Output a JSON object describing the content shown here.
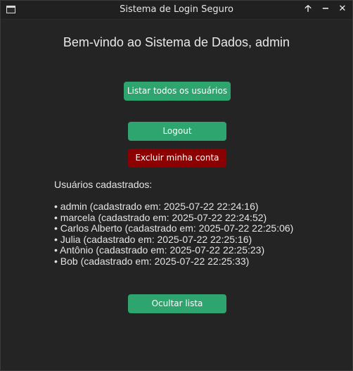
{
  "window": {
    "title": "Sistema de Login Seguro",
    "maximize_glyph": "🡡",
    "minimize_glyph": "−",
    "close_glyph": "✕"
  },
  "main": {
    "welcome": "Bem-vindo ao Sistema de Dados, admin",
    "list_users_label": "Listar todos os usuários",
    "logout_label": "Logout",
    "delete_account_label": "Excluir minha conta",
    "users_heading": "Usuários cadastrados:",
    "users": [
      "• admin (cadastrado em: 2025-07-22 22:24:16)",
      "• marcela (cadastrado em: 2025-07-22 22:24:52)",
      "• Carlos Alberto (cadastrado em: 2025-07-22 22:25:06)",
      "• Julia (cadastrado em: 2025-07-22 22:25:16)",
      "• Antônio (cadastrado em: 2025-07-22 22:25:23)",
      "• Bob (cadastrado em: 2025-07-22 22:25:33)"
    ],
    "hide_list_label": "Ocultar lista"
  },
  "colors": {
    "background": "#242424",
    "accent_green": "#2ea56f",
    "danger_red": "#8b0000"
  }
}
